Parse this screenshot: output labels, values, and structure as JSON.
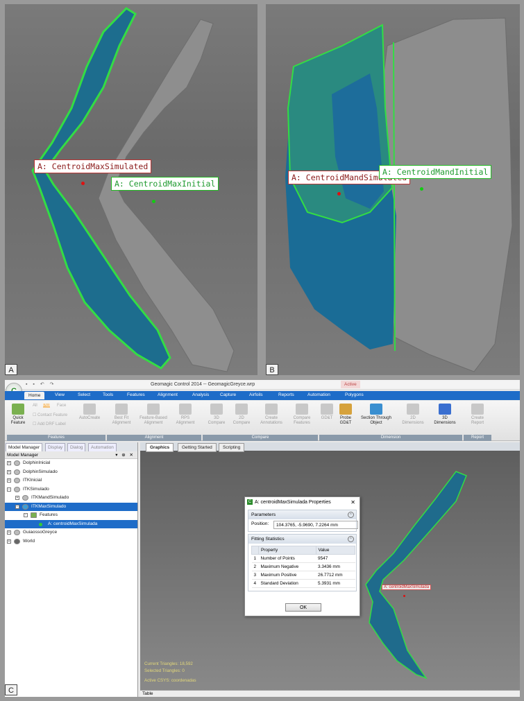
{
  "panels": {
    "a": {
      "letter": "A",
      "label_simulated": "A: CentroidMaxSimulated",
      "label_initial": "A: CentroidMaxInitial"
    },
    "b": {
      "letter": "B",
      "label_simulated": "A: CentroidMandSimulated",
      "label_initial": "A: CentroidMandInitial"
    },
    "c": {
      "letter": "C"
    }
  },
  "app": {
    "title": "Geomagic Control 2014 -- GeomagicGreyce.wrp",
    "active_badge": "Active",
    "tabs": [
      "Home",
      "View",
      "Select",
      "Tools",
      "Features",
      "Alignment",
      "Analysis",
      "Capture",
      "Airfoils",
      "Reports",
      "Automation",
      "Polygons"
    ],
    "ribbon": {
      "quick_feature": "Quick Feature",
      "filters": [
        "All",
        "Plot",
        "Face"
      ],
      "contact_feature": "Contact Feature",
      "add_drf_label": "Add DRF Label",
      "autocreate": "AutoCreate",
      "best_fit": "Best Fit Alignment",
      "feature_based": "Feature-Based Alignment",
      "rps": "RPS Alignment",
      "compare_3d": "3D Compare",
      "compare_2d": "2D Compare",
      "create_annotations": "Create Annotations",
      "compare_features": "Compare Features",
      "gdt": "GD&T",
      "probe_gdt": "Probe GD&T",
      "section_through": "Section Through Object",
      "dimensions_2d": "2D Dimensions",
      "dimensions_3d": "3D Dimensions",
      "create_report": "Create Report",
      "groups": [
        "Features",
        "Alignment",
        "Compare",
        "Dimension",
        "Report"
      ]
    },
    "sidebar": {
      "tabs": [
        "Model Manager",
        "Display",
        "Dialog",
        "Automation"
      ],
      "header": "Model Manager",
      "tree": [
        "DolphinInicial",
        "DolphinSimulado",
        "ITKInicial",
        "ITKSimulado",
        "ITKMandSimulado",
        "ITKMaxSimulado",
        "Features",
        "A: centroidMaxSimulada",
        "GuiaossoGreyce",
        "World"
      ]
    },
    "viewport": {
      "tabs": [
        "Graphics",
        "Getting Started",
        "Scripting"
      ],
      "mesh_label": "A: centroidMaxSimulada",
      "status": [
        "Current Triangles: 18,592",
        "Selected Triangles: 0",
        "Active CSYS: coordenadas"
      ],
      "table_bar": "Table"
    },
    "dialog": {
      "title": "A: centroidMaxSimulada Properties",
      "parameters_header": "Parameters",
      "position_label": "Position:",
      "position_value": "104.3765, -5.9690, 7.2264 mm",
      "fitting_header": "Fitting Statistics",
      "columns": [
        "Property",
        "Value"
      ],
      "rows": [
        {
          "n": "1",
          "property": "Number of Points",
          "value": "9547"
        },
        {
          "n": "2",
          "property": "Maximum Negative",
          "value": "3.3436 mm"
        },
        {
          "n": "3",
          "property": "Maximum Positive",
          "value": "26.7712 mm"
        },
        {
          "n": "4",
          "property": "Standard Deviation",
          "value": "5.3931 mm"
        }
      ],
      "ok": "OK"
    }
  },
  "colors": {
    "mesh_blue": "#1d6d8e",
    "mesh_teal": "#23837e",
    "mesh_grey": "#8d8d8d",
    "edge_green": "#33dd44",
    "label_red": "#8b1a1a",
    "label_green": "#1e9a2e",
    "ribbon_blue": "#1e6cc8"
  }
}
